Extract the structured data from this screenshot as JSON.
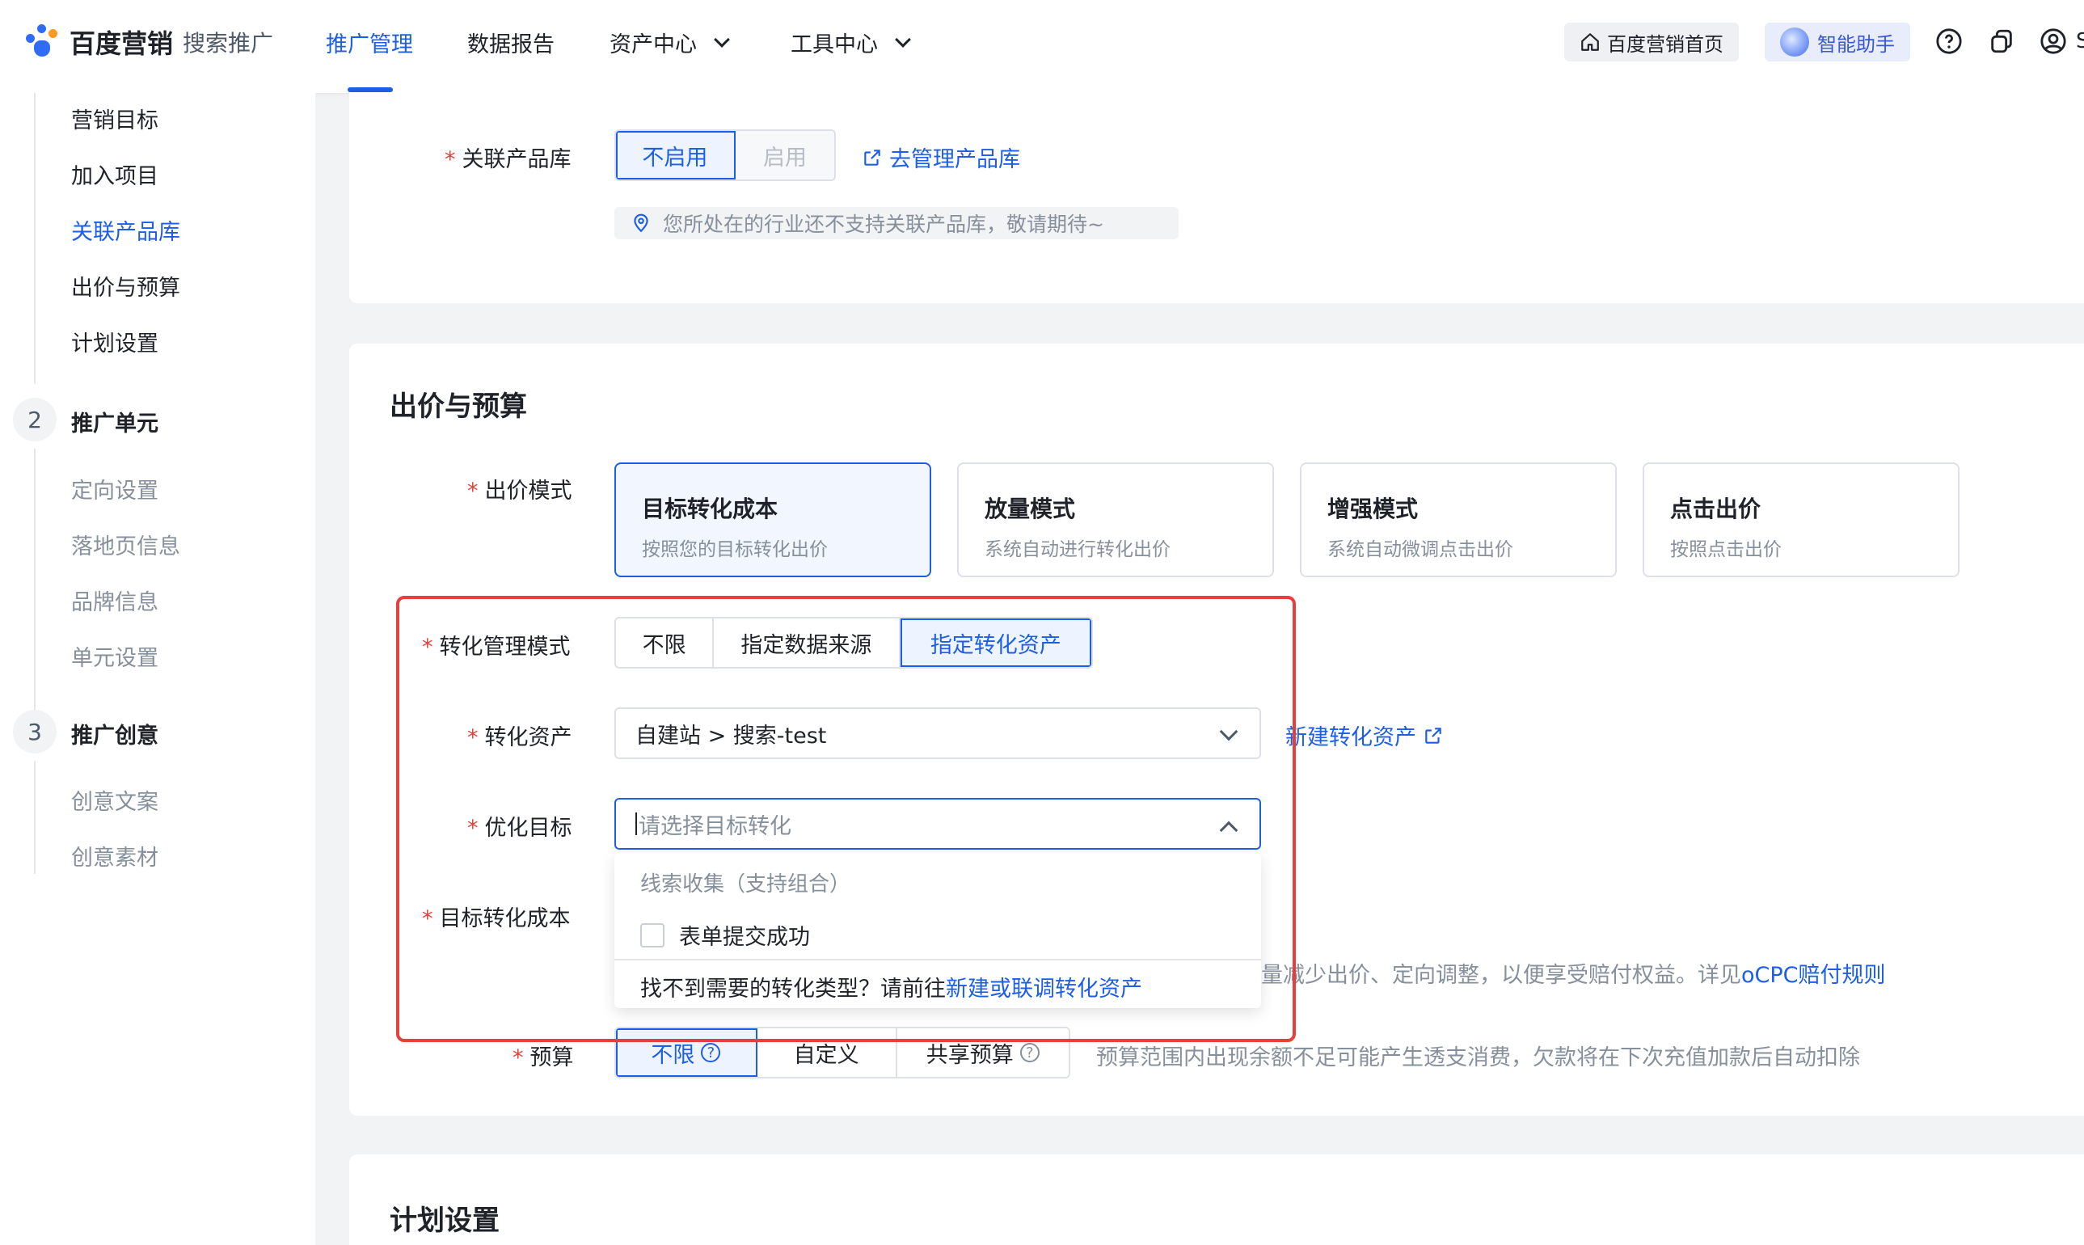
{
  "header": {
    "logo_text": "百度营销",
    "logo_sub": "搜索推广",
    "nav": [
      {
        "label": "推广管理",
        "active": true
      },
      {
        "label": "数据报告"
      },
      {
        "label": "资产中心"
      },
      {
        "label": "工具中心"
      }
    ],
    "home_label": "百度营销首页",
    "assistant_label": "智能助手",
    "truncated_user": "S"
  },
  "sidebar": {
    "group1_items": [
      "营销目标",
      "加入项目",
      "关联产品库",
      "出价与预算",
      "计划设置"
    ],
    "step2_num": "2",
    "step2_label": "推广单元",
    "group2_items": [
      "定向设置",
      "落地页信息",
      "品牌信息",
      "单元设置"
    ],
    "step3_num": "3",
    "step3_label": "推广创意",
    "group3_items": [
      "创意文案",
      "创意素材"
    ]
  },
  "product_lib": {
    "label": "关联产品库",
    "options": [
      "不启用",
      "启用"
    ],
    "manage_link": "去管理产品库",
    "notice": "您所处在的行业还不支持关联产品库，敬请期待~"
  },
  "bid": {
    "section_title": "出价与预算",
    "mode_label": "出价模式",
    "modes": [
      {
        "title": "目标转化成本",
        "desc": "按照您的目标转化出价"
      },
      {
        "title": "放量模式",
        "desc": "系统自动进行转化出价"
      },
      {
        "title": "增强模式",
        "desc": "系统自动微调点击出价"
      },
      {
        "title": "点击出价",
        "desc": "按照点击出价"
      }
    ],
    "conv_mgmt_label": "转化管理模式",
    "conv_mgmt_options": [
      "不限",
      "指定数据来源",
      "指定转化资产"
    ],
    "conv_asset_label": "转化资产",
    "conv_asset_value": "自建站 > 搜索-test",
    "new_asset_link": "新建转化资产",
    "opt_goal_label": "优化目标",
    "opt_goal_placeholder": "请选择目标转化",
    "dropdown_group": "线索收集（支持组合）",
    "dropdown_option": "表单提交成功",
    "dropdown_footer_text": "找不到需要的转化类型？请前往",
    "dropdown_footer_link": "新建或联调转化资产",
    "target_cost_label": "目标转化成本",
    "target_cost_hint_text": "量减少出价、定向调整，以便享受赔付权益。详见",
    "target_cost_hint_link": "oCPC赔付规则",
    "budget_label": "预算",
    "budget_options": [
      "不限",
      "自定义",
      "共享预算"
    ],
    "budget_hint": "预算范围内出现余额不足可能产生透支消费，欠款将在下次充值加款后自动扣除"
  },
  "plan": {
    "section_title": "计划设置"
  }
}
